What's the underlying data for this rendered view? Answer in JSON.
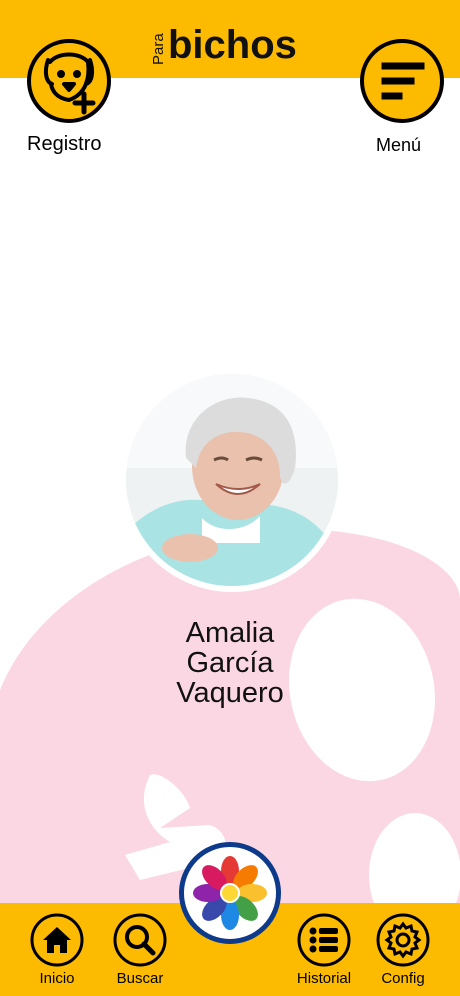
{
  "app": {
    "logo_prefix": "Para",
    "logo_main": "bichos"
  },
  "header": {
    "registro_label": "Registro",
    "menu_label": "Menú"
  },
  "profile": {
    "name_line1": "Amalia",
    "name_line2": "García",
    "name_line3": "Vaquero"
  },
  "nav": {
    "inicio": "Inicio",
    "buscar": "Buscar",
    "historial": "Historial",
    "config": "Config"
  },
  "colors": {
    "brand_yellow": "#fcbb00",
    "paw_pink": "#fbd7e3",
    "badge_blue": "#0d3a8a"
  },
  "icons": {
    "registro": "dog-plus-icon",
    "menu": "menu-lines-icon",
    "inicio": "home-icon",
    "buscar": "search-icon",
    "historial": "list-icon",
    "config": "gear-icon",
    "center": "flower-logo-icon"
  }
}
